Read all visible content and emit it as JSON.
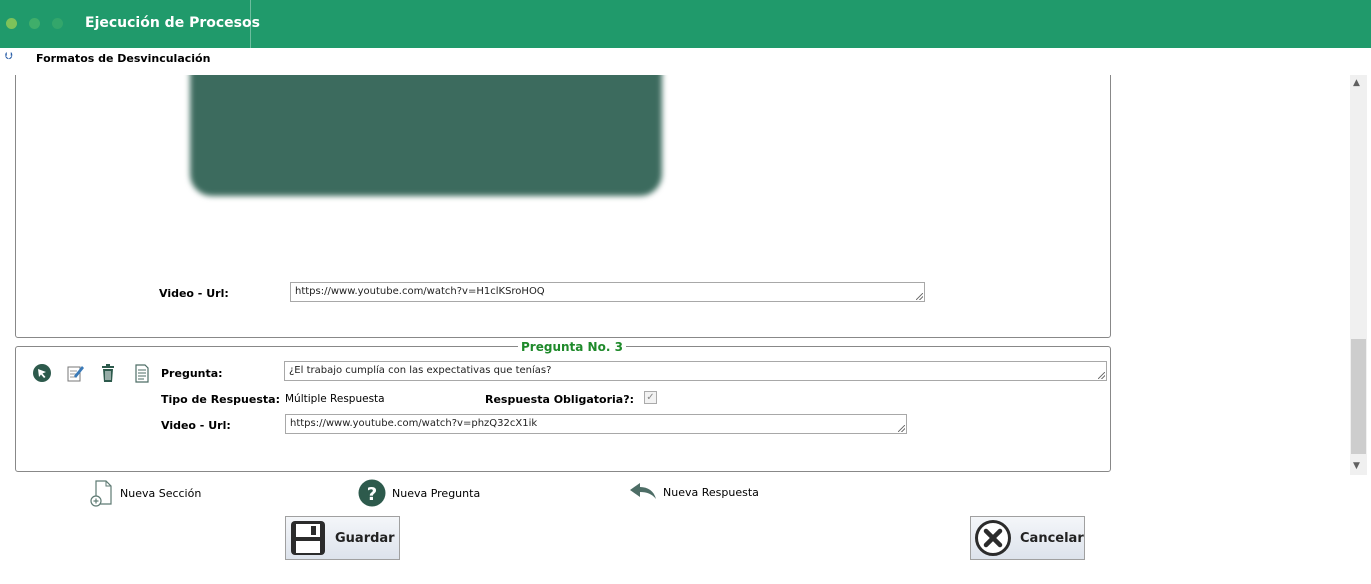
{
  "window": {
    "title": "Ejecución de Procesos",
    "dot_colors": [
      "#7dc25a",
      "#3fae6a",
      "#33a66b"
    ]
  },
  "subheader": {
    "title": "Formatos de Desvinculación"
  },
  "section1": {
    "video_label": "Video - Url:",
    "video_url": "https://www.youtube.com/watch?v=H1clKSroHOQ"
  },
  "question": {
    "legend": "Pregunta No. 3",
    "question_label": "Pregunta:",
    "question_text": "¿El trabajo cumplía con las expectativas que tenías?",
    "type_label": "Tipo de Respuesta:",
    "type_value": "Múltiple Respuesta",
    "required_label": "Respuesta Obligatoria?:",
    "required_checked": true,
    "video_label": "Video - Url:",
    "video_url": "https://www.youtube.com/watch?v=phzQ32cX1ik"
  },
  "actions": {
    "new_section": "Nueva Sección",
    "new_question": "Nueva Pregunta",
    "new_answer": "Nueva Respuesta"
  },
  "buttons": {
    "save": "Guardar",
    "cancel": "Cancelar"
  },
  "colors": {
    "header": "#209a6b",
    "legend": "#1f8a2b",
    "icon_dark": "#2d5a4c"
  }
}
